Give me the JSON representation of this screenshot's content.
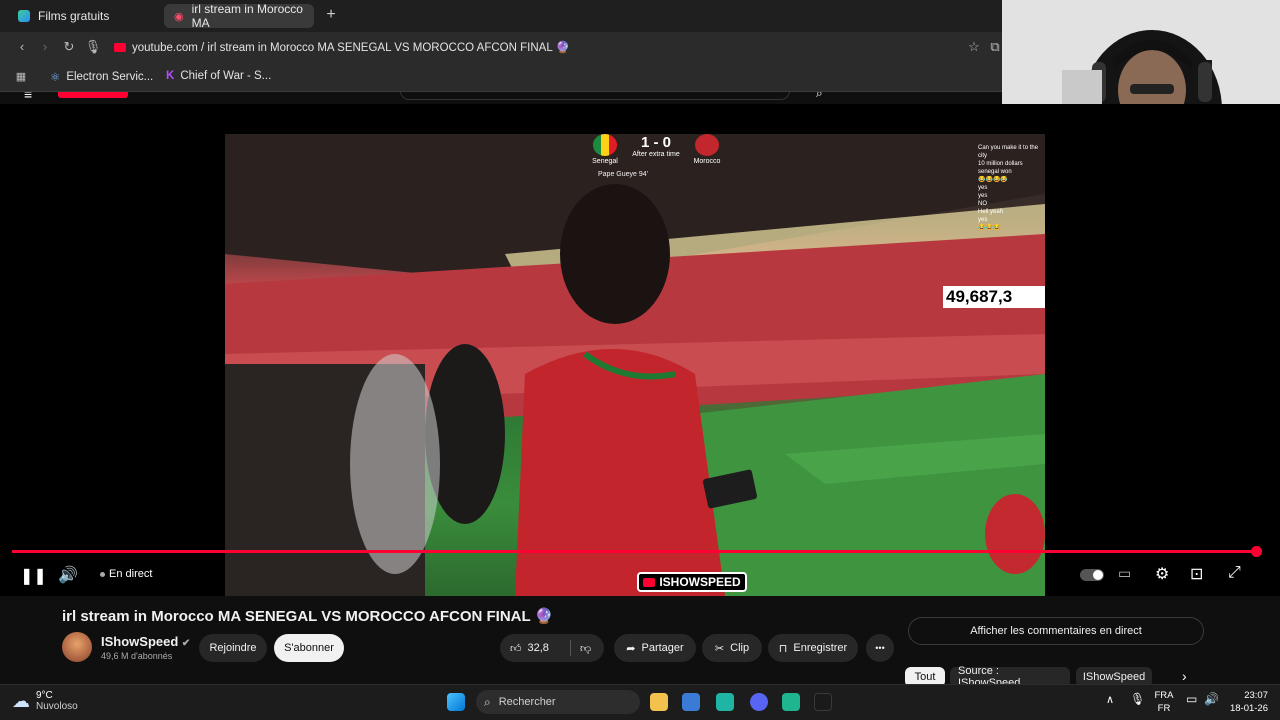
{
  "browser": {
    "tabs": [
      {
        "label": "Films gratuits"
      },
      {
        "label": "irl stream in Morocco MA"
      }
    ],
    "new_tab_label": "+",
    "url": "youtube.com / irl stream in Morocco MA SENEGAL VS MOROCCO AFCON FINAL 🔮",
    "bookmarks": [
      {
        "label": "Electron Servic..."
      },
      {
        "label": "Chief of War - S..."
      }
    ]
  },
  "overlay": {
    "team_home": "Senegal",
    "team_away": "Morocco",
    "score": "1 - 0",
    "score_status": "After extra time",
    "scorer": "Pape Gueye 94'",
    "viewer_count": "49,687,3",
    "chat_lines": [
      "Can you make it to the city",
      "10 million dollars",
      "senegal won",
      "😂😂😂😂",
      "yes",
      "yes",
      "NO",
      "Hell yeah",
      "yes",
      "😂😂😂"
    ],
    "watermark": "ISHOWSPEED"
  },
  "player": {
    "live_label": "En direct",
    "progress_fraction": 1.0
  },
  "video": {
    "title": "irl stream in Morocco MA SENEGAL VS MOROCCO AFCON FINAL 🔮",
    "channel_name": "IShowSpeed",
    "subscribers": "49,6 M d'abonnés",
    "join_label": "Rejoindre",
    "subscribe_label": "S'abonner",
    "like_count": "32,8",
    "share_label": "Partager",
    "clip_label": "Clip",
    "save_label": "Enregistrer",
    "more_label": "•••"
  },
  "sidebar": {
    "live_chat_button": "Afficher les commentaires en direct",
    "chips": [
      {
        "label": "Tout"
      },
      {
        "label": "Source : IShowSpeed"
      },
      {
        "label": "IShowSpeed"
      }
    ]
  },
  "taskbar": {
    "temperature": "9°C",
    "weather": "Nuvoloso",
    "search_placeholder": "Rechercher",
    "lang_top": "FRA",
    "lang_bottom": "FR",
    "time": "23:07",
    "date": "18-01-26"
  },
  "colors": {
    "accent": "#ff0033",
    "background": "#0f0f0f",
    "pitch": "#3a8d3c"
  }
}
